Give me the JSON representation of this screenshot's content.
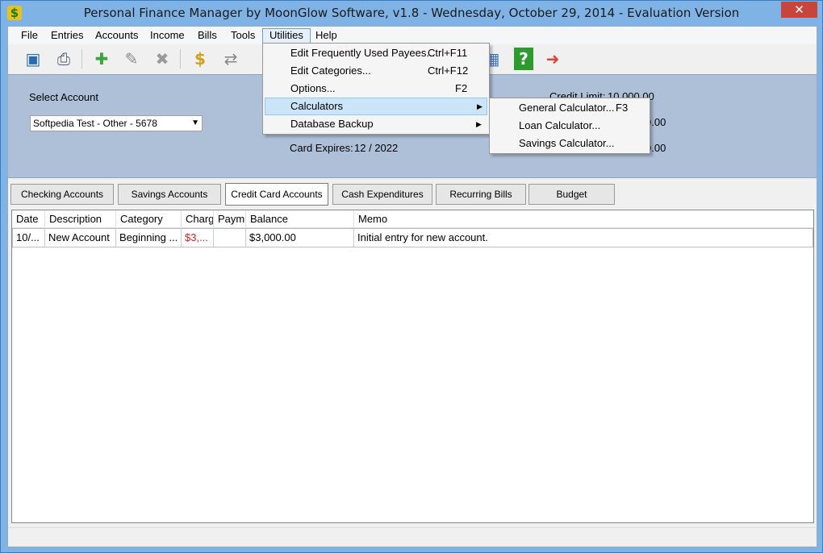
{
  "window": {
    "title": "Personal Finance Manager by MoonGlow Software, v1.8  -  Wednesday, October 29, 2014  -  Evaluation Version",
    "close_glyph": "✕"
  },
  "menubar": {
    "items": [
      "File",
      "Entries",
      "Accounts",
      "Income",
      "Bills",
      "Tools",
      "Utilities",
      "Help"
    ],
    "open": "Utilities"
  },
  "toolbar": {
    "icons": [
      "accounts-icon",
      "print-icon",
      "add-icon",
      "edit-icon",
      "delete-icon",
      "money-icon",
      "transfer-icon",
      "calculator-icon",
      "help-icon",
      "exit-icon"
    ]
  },
  "account_panel": {
    "select_label": "Select Account",
    "selected_account": "Softpedia Test - Other - 5678",
    "credit_limit_label": "Credit Limit:",
    "credit_limit_value": "10,000.00",
    "value_2": "0.00",
    "value_3": "0.00",
    "card_expires_label": "Card Expires:",
    "card_expires_value": "12 / 2022"
  },
  "tabs": [
    {
      "label": "Checking Accounts",
      "active": false
    },
    {
      "label": "Savings Accounts",
      "active": false
    },
    {
      "label": "Credit Card Accounts",
      "active": true
    },
    {
      "label": "Cash Expenditures",
      "active": false
    },
    {
      "label": "Recurring Bills",
      "active": false
    },
    {
      "label": "Budget",
      "active": false
    }
  ],
  "grid": {
    "columns": [
      "Date",
      "Description",
      "Category",
      "Charg",
      "Paym",
      "Balance",
      "Memo"
    ],
    "rows": [
      [
        "10/...",
        "New Account",
        "Beginning ...",
        "$3,...",
        "",
        "$3,000.00",
        "Initial entry for new account."
      ]
    ]
  },
  "utilities_menu": [
    {
      "label": "Edit Frequently Used Payees...",
      "shortcut": "Ctrl+F11",
      "submenu": false
    },
    {
      "label": "Edit Categories...",
      "shortcut": "Ctrl+F12",
      "submenu": false
    },
    {
      "label": "Options...",
      "shortcut": "F2",
      "submenu": false
    },
    {
      "label": "Calculators",
      "shortcut": "",
      "submenu": true
    },
    {
      "label": "Database Backup",
      "shortcut": "",
      "submenu": true
    }
  ],
  "calculators_submenu": [
    {
      "label": "General Calculator...",
      "shortcut": "F3"
    },
    {
      "label": "Loan Calculator...",
      "shortcut": ""
    },
    {
      "label": "Savings Calculator...",
      "shortcut": ""
    }
  ],
  "colors": {
    "panel": "#aec0d8",
    "highlight": "#cce4f7",
    "negative": "#e02020"
  }
}
